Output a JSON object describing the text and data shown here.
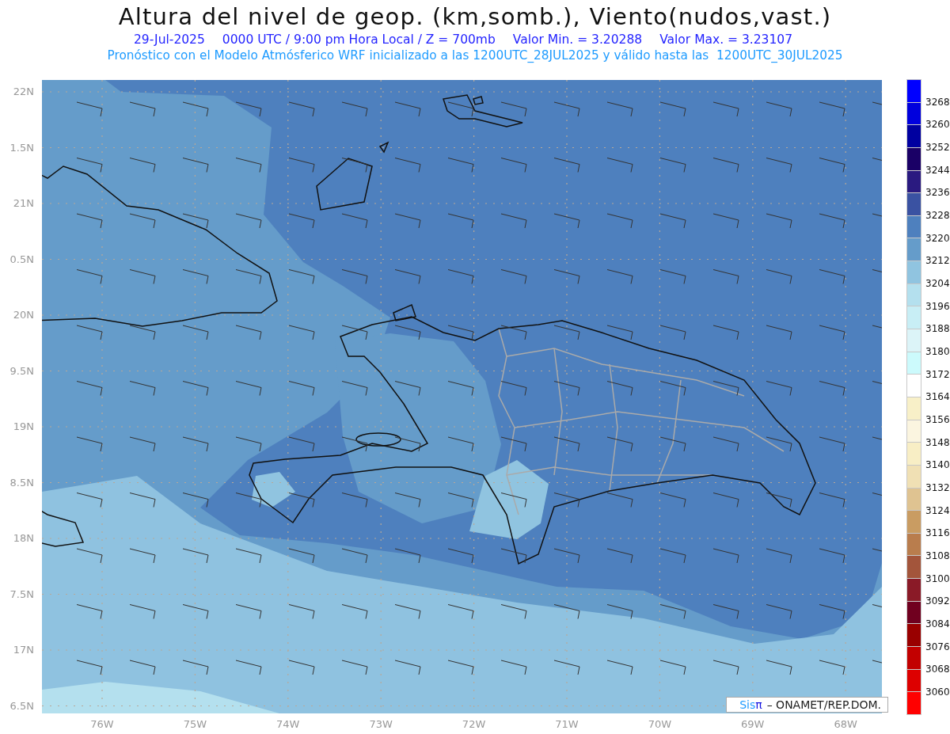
{
  "title": "Altura del nivel de geop. (km,somb.), Viento(nudos,vast.)",
  "subtitle": [
    "29-Jul-2025",
    "0000 UTC / 9:00 pm Hora Local / Z = 700mb",
    "Valor Min. = 3.20288",
    "Valor Max. = 3.23107"
  ],
  "description": "Pronóstico con el Modelo Atmósferico WRF inicializado a las 1200UTC_28JUL2025 y válido hasta las  1200UTC_30JUL2025",
  "map": {
    "y_axis": [
      "22N",
      "1.5N",
      "21N",
      "0.5N",
      "20N",
      "9.5N",
      "19N",
      "8.5N",
      "18N",
      "7.5N",
      "17N",
      "6.5N"
    ],
    "x_axis": [
      "76W",
      "75W",
      "74W",
      "73W",
      "72W",
      "71W",
      "70W",
      "69W",
      "68W"
    ],
    "credit": {
      "logo_parts": [
        {
          "text": "Sis",
          "color": "#1e9bff"
        },
        {
          "text": "π",
          "color": "#1010e0"
        }
      ],
      "text": "– ONAMET/REP.DOM."
    }
  },
  "legend": {
    "colors": [
      {
        "color": "#0000ff"
      },
      {
        "color": "#0000dd"
      },
      {
        "color": "#0000a0"
      },
      {
        "color": "#1a0066"
      },
      {
        "color": "#2a1a80"
      },
      {
        "color": "#3a52a2"
      },
      {
        "color": "#4e80be"
      },
      {
        "color": "#659cca"
      },
      {
        "color": "#90c4e0"
      },
      {
        "color": "#b4e0ee"
      },
      {
        "color": "#c8eef5"
      },
      {
        "color": "#dcf4f8"
      },
      {
        "color": "#ccfafc"
      },
      {
        "color": "#ffffff"
      },
      {
        "color": "#f8f0c8"
      },
      {
        "color": "#fbf5e0"
      },
      {
        "color": "#f8eec5"
      },
      {
        "color": "#f0e0b4"
      },
      {
        "color": "#dfc391"
      },
      {
        "color": "#c99c62"
      },
      {
        "color": "#b97d4d"
      },
      {
        "color": "#a3553b"
      },
      {
        "color": "#8a1a27"
      },
      {
        "color": "#70001f"
      },
      {
        "color": "#990000"
      },
      {
        "color": "#c20000"
      },
      {
        "color": "#dd0000"
      },
      {
        "color": "#ff0000"
      }
    ],
    "labels": [
      "3268",
      "3260",
      "3252",
      "3244",
      "3236",
      "3228",
      "3220",
      "3212",
      "3204",
      "3196",
      "3188",
      "3180",
      "3172",
      "3164",
      "3156",
      "3148",
      "3140",
      "3132",
      "3124",
      "3116",
      "3108",
      "3100",
      "3092",
      "3084",
      "3076",
      "3068",
      "3060"
    ]
  }
}
